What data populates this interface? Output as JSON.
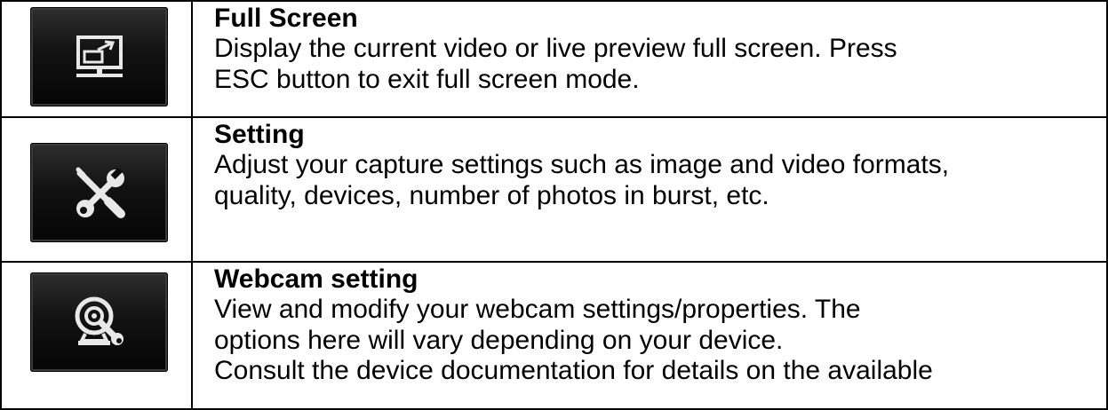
{
  "rows": [
    {
      "icon": "fullscreen-monitor-icon",
      "title": "Full Screen",
      "description": "Display the current video or live preview full screen. Press\nESC button to exit full screen mode."
    },
    {
      "icon": "wrench-screwdriver-icon",
      "title": "Setting",
      "description": "Adjust your capture settings such as image and video formats,\nquality, devices, number of photos in burst, etc."
    },
    {
      "icon": "webcam-wrench-icon",
      "title": "Webcam setting",
      "description": "View and modify your webcam settings/properties. The\noptions here will vary depending on your device.\nConsult the device documentation for details on the available"
    }
  ],
  "colors": {
    "tile_background": "#0a0a0a",
    "icon_glyph": "#e8e8e8",
    "border": "#000000"
  }
}
